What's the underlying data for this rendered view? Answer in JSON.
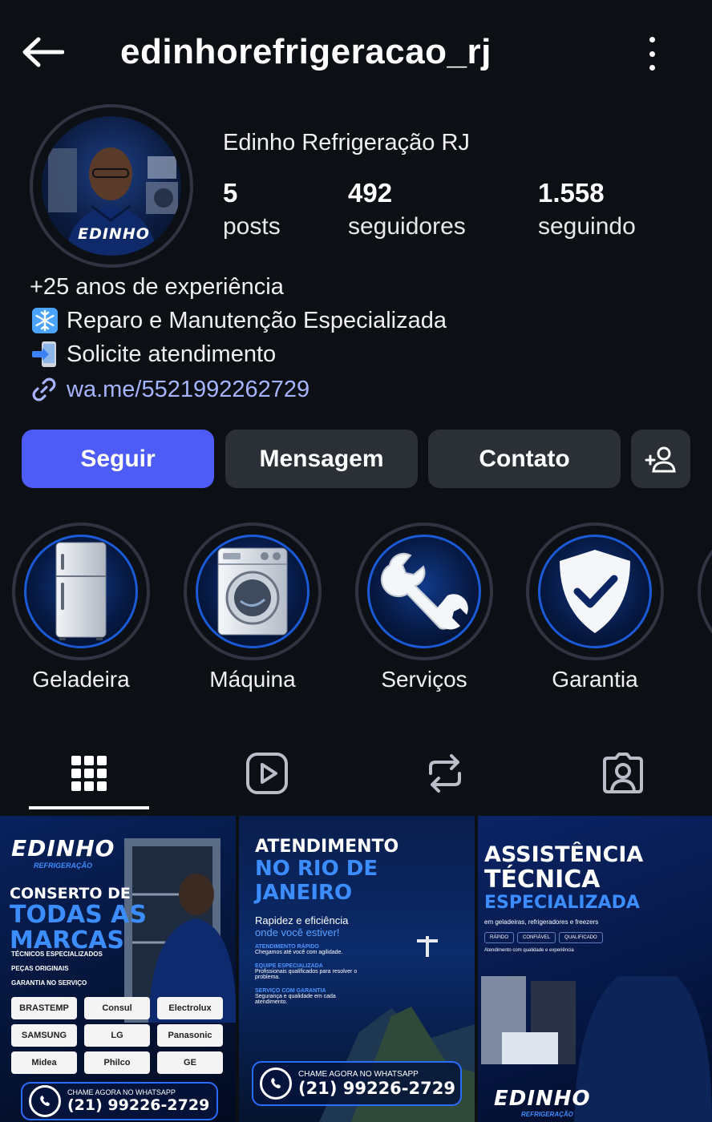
{
  "header": {
    "username": "edinhorefrigeracao_rj"
  },
  "profile": {
    "display_name": "Edinho Refrigeração RJ",
    "avatar_logo": "EDINHO",
    "stats": [
      {
        "value": "5",
        "label": "posts"
      },
      {
        "value": "492",
        "label": "seguidores"
      },
      {
        "value": "1.558",
        "label": "seguindo"
      }
    ],
    "bio": [
      "+25 anos de experiência",
      "Reparo e Manutenção Especializada",
      "Solicite atendimento"
    ],
    "link": "wa.me/5521992262729"
  },
  "actions": {
    "follow": "Seguir",
    "message": "Mensagem",
    "contact": "Contato"
  },
  "highlights": [
    {
      "label": "Geladeira",
      "icon": "fridge-icon"
    },
    {
      "label": "Máquina",
      "icon": "washing-machine-icon"
    },
    {
      "label": "Serviços",
      "icon": "wrench-icon"
    },
    {
      "label": "Garantia",
      "icon": "shield-check-icon"
    }
  ],
  "tabs": [
    "grid-icon",
    "reels-icon",
    "reposts-icon",
    "tagged-icon"
  ],
  "posts": {
    "p1": {
      "logo": "EDINHO",
      "logo_sub": "REFRIGERAÇÃO",
      "line1": "CONSERTO DE",
      "line2": "TODAS AS",
      "line3": "MARCAS",
      "bullets": [
        "TÉCNICOS ESPECIALIZADOS",
        "PEÇAS ORIGINAIS",
        "GARANTIA NO SERVIÇO"
      ],
      "brands": [
        "BRASTEMP",
        "Consul",
        "Electrolux",
        "SAMSUNG",
        "LG",
        "Panasonic",
        "Midea",
        "Philco",
        "GE"
      ],
      "cta": "CHAME AGORA NO WHATSAPP",
      "phone": "(21) 99226-2729"
    },
    "p2": {
      "title1": "ATENDIMENTO",
      "title2": "NO RIO DE JANEIRO",
      "sub1": "Rapidez e eficiência",
      "sub2": "onde você estiver!",
      "items": [
        {
          "title": "ATENDIMENTO RÁPIDO",
          "text": "Chegamos até você com agilidade."
        },
        {
          "title": "EQUIPE ESPECIALIZADA",
          "text": "Profissionais qualificados para resolver o problema."
        },
        {
          "title": "SERVIÇO COM GARANTIA",
          "text": "Segurança e qualidade em cada atendimento."
        }
      ],
      "cta": "CHAME AGORA NO WHATSAPP",
      "phone": "(21) 99226-2729"
    },
    "p3": {
      "title1": "ASSISTÊNCIA",
      "title2": "TÉCNICA",
      "title3": "ESPECIALIZADA",
      "sub": "em geladeiras, refrigeradores e freezers",
      "tags": [
        "RÁPIDO",
        "CONFIÁVEL",
        "QUALIFICADO"
      ],
      "note": "Atendimento com qualidade e experiência",
      "logo": "EDINHO",
      "logo_sub": "REFRIGERAÇÃO"
    }
  },
  "colors": {
    "background": "#0c0f14",
    "primary_button": "#4d5bf7",
    "secondary_button": "#2b2f36",
    "link": "#a6b4ff",
    "post_blue": "#3c8dff"
  }
}
